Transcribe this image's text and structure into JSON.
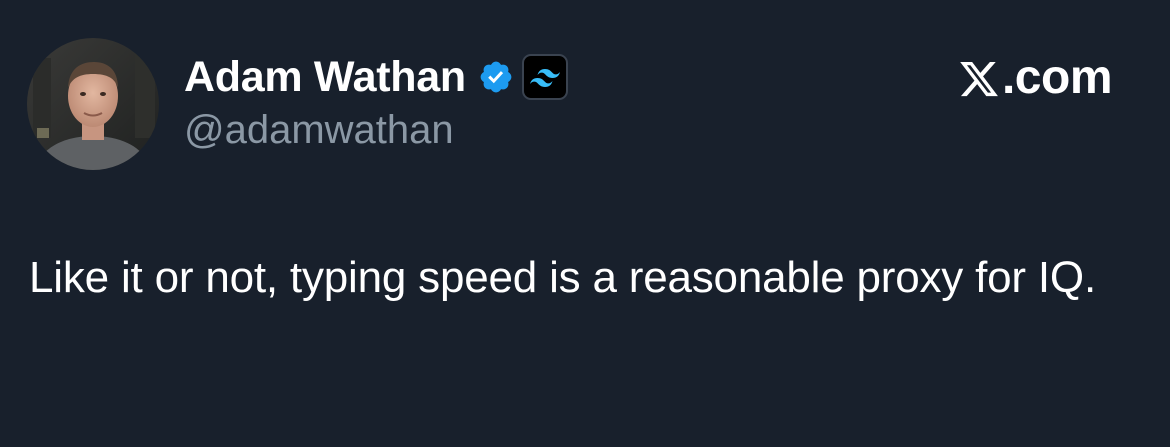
{
  "author": {
    "display_name": "Adam Wathan",
    "handle": "@adamwathan",
    "verified": true,
    "verified_icon": "verified-badge-icon",
    "affiliate_icon": "tailwind-logo-icon",
    "avatar_icon": "profile-photo"
  },
  "brand": {
    "logo_icon": "x-logo-icon",
    "label": ".com"
  },
  "tweet": {
    "text": "Like it or not, typing speed is a reasonable proxy for IQ."
  },
  "colors": {
    "background": "#18202c",
    "text_primary": "#ffffff",
    "text_secondary": "#8b98a5",
    "verified_blue": "#1d9bf0",
    "tailwind_cyan": "#38bdf8"
  }
}
